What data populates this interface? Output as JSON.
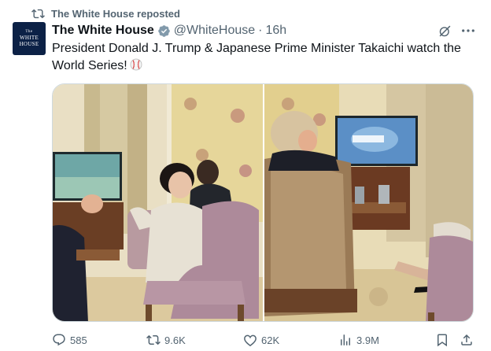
{
  "repost": {
    "text": "The White House reposted"
  },
  "post": {
    "avatar": {
      "line1": "The",
      "line2": "WHITE",
      "line3": "HOUSE"
    },
    "author_name": "The White House",
    "handle": "@WhiteHouse",
    "separator": "·",
    "time": "16h",
    "text": "President Donald J. Trump & Japanese Prime Minister Takaichi watch the World Series!",
    "verified_badge_color": "#829aab"
  },
  "actions": {
    "replies": "585",
    "reposts": "9.6K",
    "likes": "62K",
    "views": "3.9M"
  },
  "colors": {
    "text_primary": "#0f1419",
    "text_secondary": "#536471",
    "border": "#cfd9de",
    "avatar_bg": "#0c2146"
  }
}
